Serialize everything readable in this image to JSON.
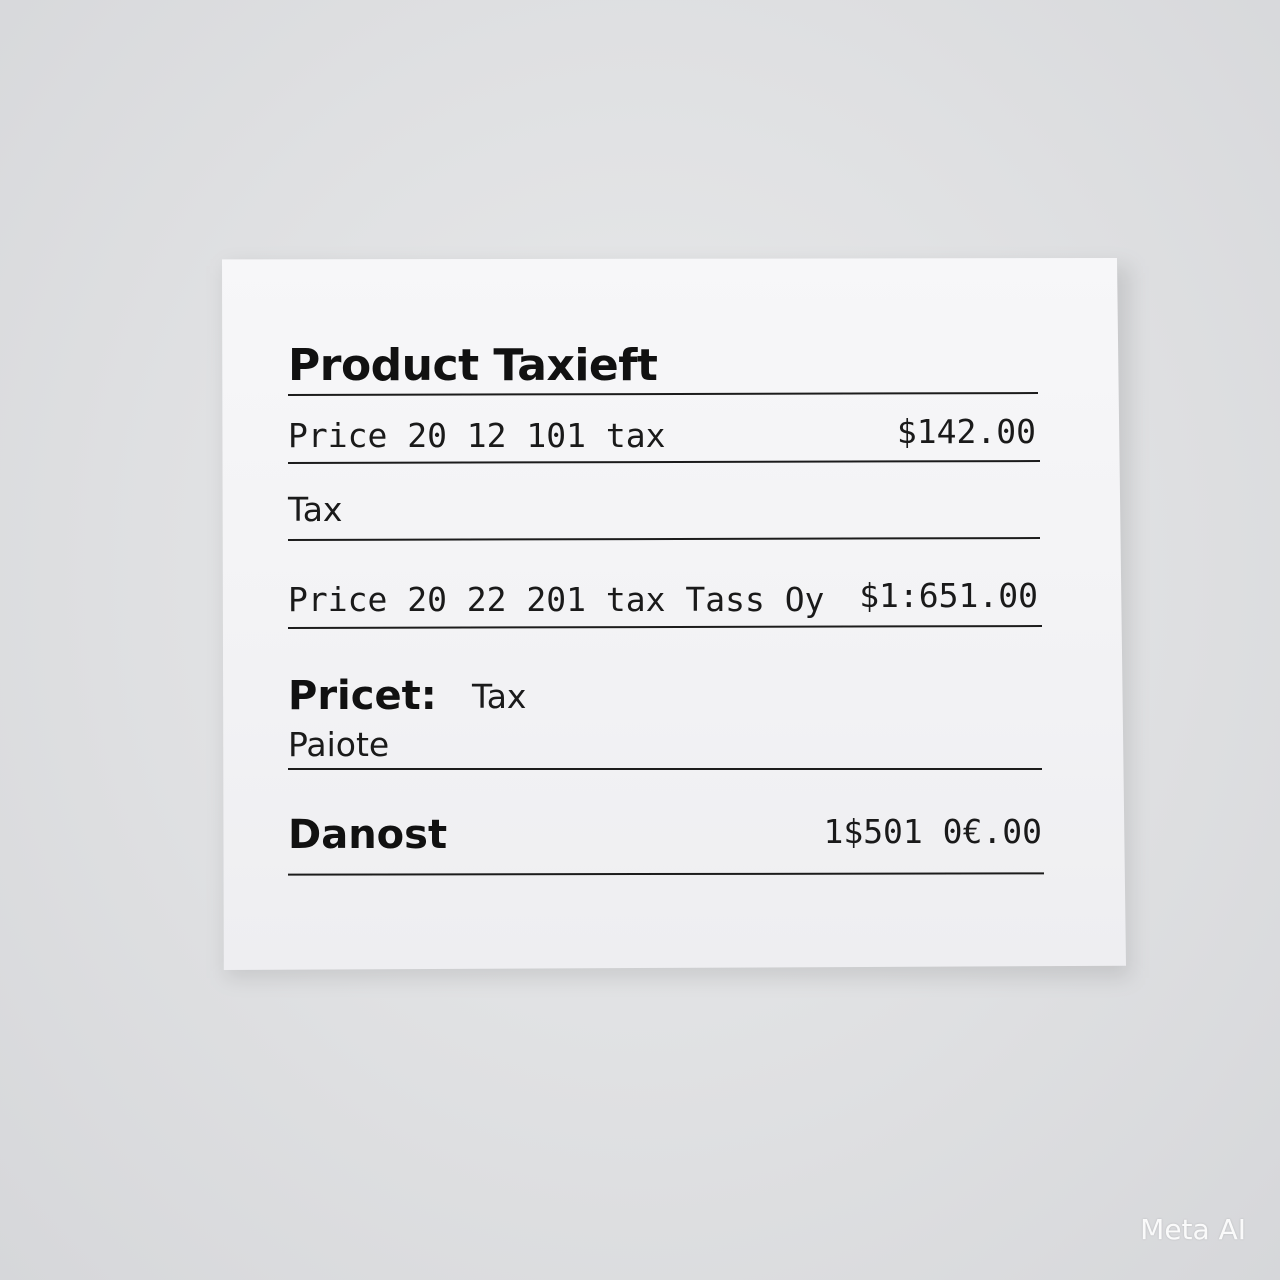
{
  "receipt": {
    "title": "Product Taxieft",
    "row1": {
      "label": "Price 20 12 101 tax",
      "amount": "$142.00"
    },
    "row2": {
      "label": "Tax"
    },
    "row3": {
      "label": "Price 20 22 201 tax Tass Oy",
      "amount": "$1:651.00"
    },
    "row4": {
      "label_bold": "Pricet:",
      "label_extra": "Tax",
      "sub": "Paiote"
    },
    "row5": {
      "label": "Danost",
      "amount": "1$501 0€.00"
    }
  },
  "watermark": "Meta AI"
}
